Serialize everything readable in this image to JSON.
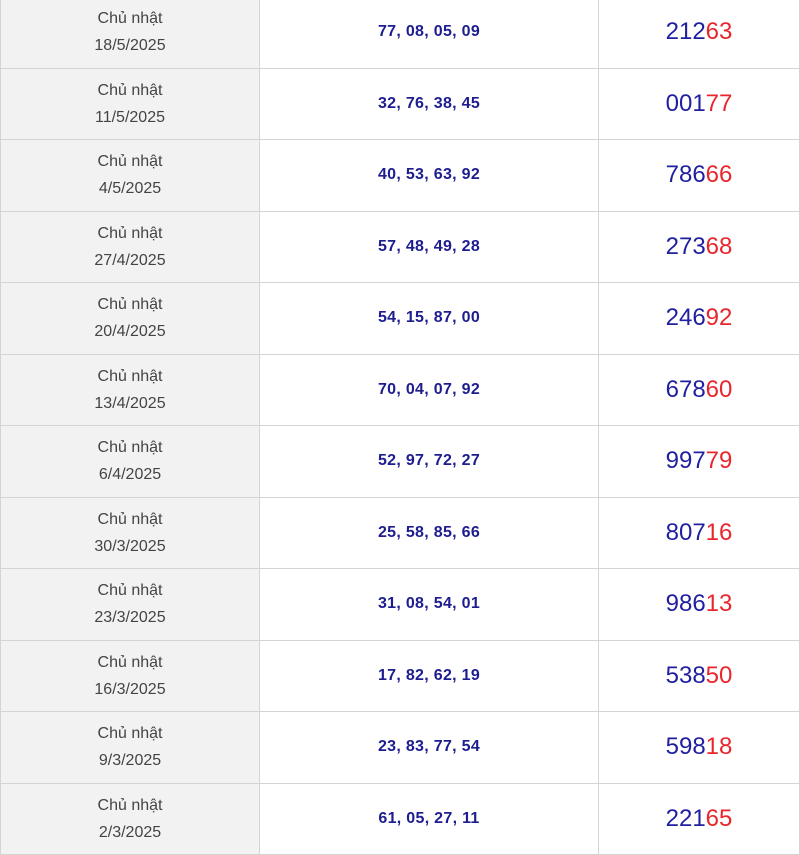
{
  "colors": {
    "accent_blue": "#1f1fa0",
    "accent_red": "#e8262c",
    "date_bg": "#f2f2f2",
    "border": "#d4d4d4"
  },
  "rows": [
    {
      "day": "Chủ nhật",
      "date": "18/5/2025",
      "pairs": "77, 08, 05, 09",
      "special_head": "212",
      "special_tail": "63"
    },
    {
      "day": "Chủ nhật",
      "date": "11/5/2025",
      "pairs": "32, 76, 38, 45",
      "special_head": "001",
      "special_tail": "77"
    },
    {
      "day": "Chủ nhật",
      "date": "4/5/2025",
      "pairs": "40, 53, 63, 92",
      "special_head": "786",
      "special_tail": "66"
    },
    {
      "day": "Chủ nhật",
      "date": "27/4/2025",
      "pairs": "57, 48, 49, 28",
      "special_head": "273",
      "special_tail": "68"
    },
    {
      "day": "Chủ nhật",
      "date": "20/4/2025",
      "pairs": "54, 15, 87, 00",
      "special_head": "246",
      "special_tail": "92"
    },
    {
      "day": "Chủ nhật",
      "date": "13/4/2025",
      "pairs": "70, 04, 07, 92",
      "special_head": "678",
      "special_tail": "60"
    },
    {
      "day": "Chủ nhật",
      "date": "6/4/2025",
      "pairs": "52, 97, 72, 27",
      "special_head": "997",
      "special_tail": "79"
    },
    {
      "day": "Chủ nhật",
      "date": "30/3/2025",
      "pairs": "25, 58, 85, 66",
      "special_head": "807",
      "special_tail": "16"
    },
    {
      "day": "Chủ nhật",
      "date": "23/3/2025",
      "pairs": "31, 08, 54, 01",
      "special_head": "986",
      "special_tail": "13"
    },
    {
      "day": "Chủ nhật",
      "date": "16/3/2025",
      "pairs": "17, 82, 62, 19",
      "special_head": "538",
      "special_tail": "50"
    },
    {
      "day": "Chủ nhật",
      "date": "9/3/2025",
      "pairs": "23, 83, 77, 54",
      "special_head": "598",
      "special_tail": "18"
    },
    {
      "day": "Chủ nhật",
      "date": "2/3/2025",
      "pairs": "61, 05, 27, 11",
      "special_head": "221",
      "special_tail": "65"
    }
  ]
}
